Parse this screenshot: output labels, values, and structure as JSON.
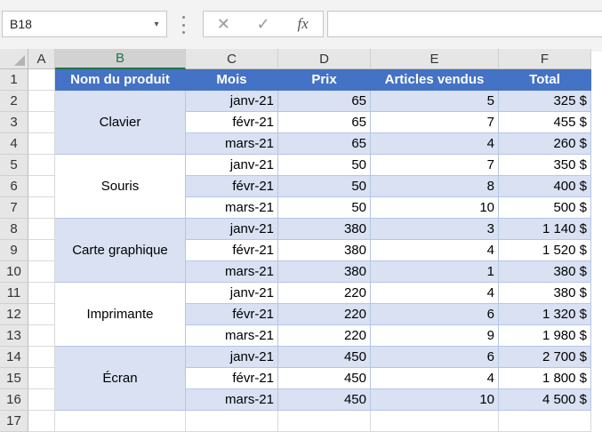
{
  "formula_bar": {
    "name_box": "B18",
    "name_box_arrow": "▾",
    "cancel": "✕",
    "enter": "✓",
    "fx": "fx",
    "formula": ""
  },
  "columns": [
    "A",
    "B",
    "C",
    "D",
    "E",
    "F"
  ],
  "selected_column": "B",
  "rows": [
    "1",
    "2",
    "3",
    "4",
    "5",
    "6",
    "7",
    "8",
    "9",
    "10",
    "11",
    "12",
    "13",
    "14",
    "15",
    "16",
    "17"
  ],
  "table": {
    "headers": [
      "Nom du produit",
      "Mois",
      "Prix",
      "Articles vendus",
      "Total"
    ],
    "products": [
      "Clavier",
      "Souris",
      "Carte graphique",
      "Imprimante",
      "Écran"
    ],
    "rows": [
      [
        "janv-21",
        "65",
        "5",
        "325 $"
      ],
      [
        "févr-21",
        "65",
        "7",
        "455 $"
      ],
      [
        "mars-21",
        "65",
        "4",
        "260 $"
      ],
      [
        "janv-21",
        "50",
        "7",
        "350 $"
      ],
      [
        "févr-21",
        "50",
        "8",
        "400 $"
      ],
      [
        "mars-21",
        "50",
        "10",
        "500 $"
      ],
      [
        "janv-21",
        "380",
        "3",
        "1 140 $"
      ],
      [
        "févr-21",
        "380",
        "4",
        "1 520 $"
      ],
      [
        "mars-21",
        "380",
        "1",
        "380 $"
      ],
      [
        "janv-21",
        "220",
        "4",
        "380 $"
      ],
      [
        "févr-21",
        "220",
        "6",
        "1 320 $"
      ],
      [
        "mars-21",
        "220",
        "9",
        "1 980 $"
      ],
      [
        "janv-21",
        "450",
        "6",
        "2 700 $"
      ],
      [
        "févr-21",
        "450",
        "4",
        "1 800 $"
      ],
      [
        "mars-21",
        "450",
        "10",
        "4 500 $"
      ]
    ]
  },
  "colors": {
    "header_bg": "#4472c4",
    "band_bg": "#d9e1f2",
    "selection_accent": "#217346"
  }
}
